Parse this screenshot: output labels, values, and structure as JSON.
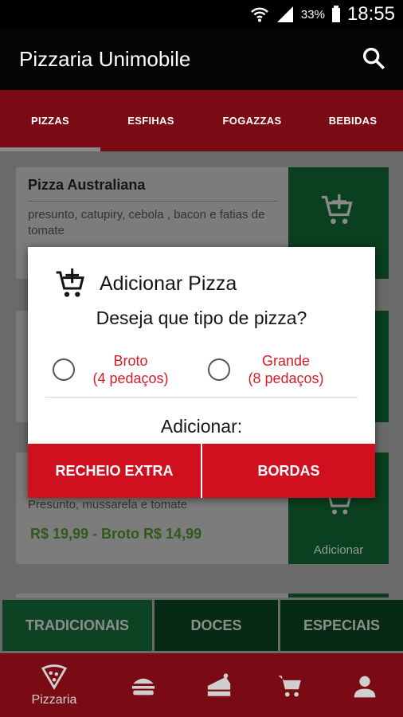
{
  "status_bar": {
    "battery": "33%",
    "time": "18:55"
  },
  "app_bar": {
    "title": "Pizzaria Unimobile",
    "search_icon": "search-icon"
  },
  "tabs": [
    {
      "label": "PIZZAS",
      "selected": true
    },
    {
      "label": "ESFIHAS"
    },
    {
      "label": "FOGAZZAS"
    },
    {
      "label": "BEBIDAS"
    }
  ],
  "menu_items": [
    {
      "title": "Pizza Australiana",
      "description": "presunto, catupiry, cebola , bacon e fatias de tomate"
    },
    {
      "title": "",
      "description": ""
    },
    {
      "title": "",
      "description": "Presunto, mussarela e tomate",
      "price": "R$ 19,99 - Broto R$ 14,99",
      "add_label": "Adicionar"
    }
  ],
  "categories": [
    {
      "label": "TRADICIONAIS",
      "selected": true
    },
    {
      "label": "DOCES"
    },
    {
      "label": "ESPECIAIS"
    }
  ],
  "bottom_nav": [
    {
      "label": "Pizzaria",
      "icon": "pizza-slice-icon",
      "selected": true
    },
    {
      "label": "",
      "icon": "burger-icon"
    },
    {
      "label": "",
      "icon": "cake-icon"
    },
    {
      "label": "",
      "icon": "cart-icon"
    },
    {
      "label": "",
      "icon": "person-icon"
    }
  ],
  "dialog": {
    "icon": "add-cart-icon",
    "title": "Adicionar Pizza",
    "question": "Deseja que tipo de pizza?",
    "options": [
      {
        "line1": "Broto",
        "line2": "(4 pedaços)",
        "checked": false
      },
      {
        "line1": "Grande",
        "line2": "(8 pedaços)",
        "checked": false
      }
    ],
    "add_label": "Adicionar:",
    "buttons": {
      "extra": "RECHEIO EXTRA",
      "borders": "BORDAS"
    }
  },
  "colors": {
    "primary_red": "#d1101f",
    "dark_green": "#0a3f1f",
    "radio_label_red": "#d81b27"
  }
}
